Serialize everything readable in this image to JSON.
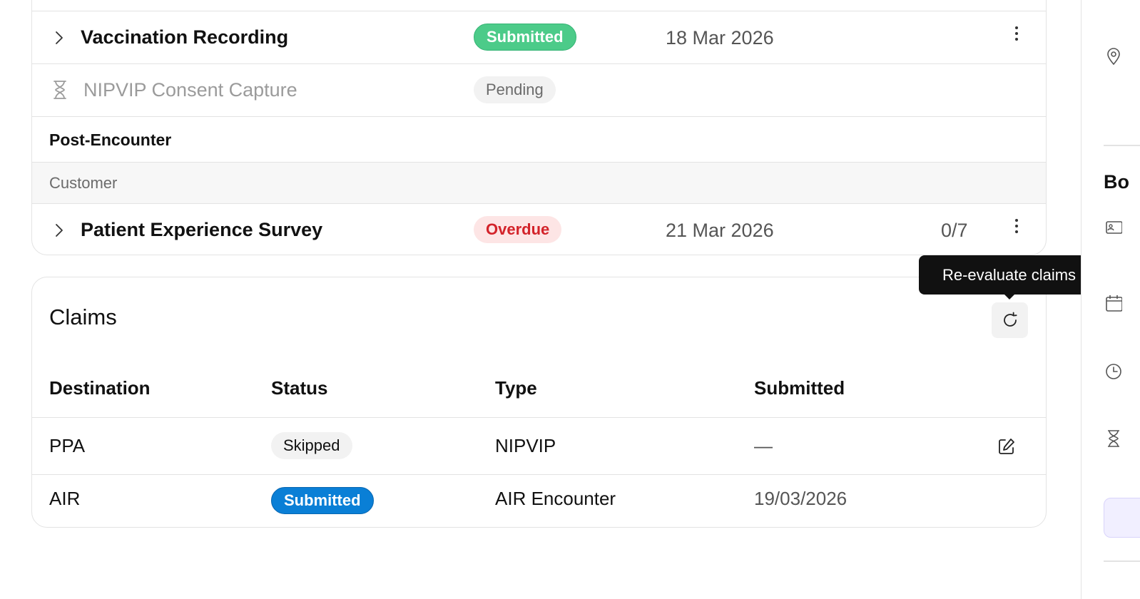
{
  "tasks": {
    "rows": [
      {
        "name": "Vaccination Recording",
        "status": "Submitted",
        "date": "18 Mar 2026"
      },
      {
        "name": "NIPVIP Consent Capture",
        "status": "Pending"
      }
    ],
    "section": "Post-Encounter",
    "group": "Customer",
    "post_rows": [
      {
        "name": "Patient Experience Survey",
        "status": "Overdue",
        "date": "21 Mar 2026",
        "count": "0/7"
      }
    ]
  },
  "claims": {
    "title": "Claims",
    "refresh_tooltip": "Re-evaluate claims",
    "columns": [
      "Destination",
      "Status",
      "Type",
      "Submitted"
    ],
    "rows": [
      {
        "destination": "PPA",
        "status": "Skipped",
        "type": "NIPVIP",
        "submitted": "—"
      },
      {
        "destination": "AIR",
        "status": "Submitted",
        "type": "AIR Encounter",
        "submitted": "19/03/2026"
      }
    ]
  },
  "side_panel": {
    "heading": "Bo"
  },
  "colors": {
    "submitted_green": "#4ccb89",
    "submitted_blue": "#0a7fd6",
    "overdue_bg": "#fde5e5",
    "overdue_text": "#d3232a",
    "pending_bg": "#f2f2f2"
  },
  "icons": [
    "chevron-right-icon",
    "hourglass-icon",
    "kebab-menu-icon",
    "refresh-icon",
    "edit-icon",
    "location-pin-icon",
    "id-card-icon",
    "calendar-icon",
    "clock-icon"
  ]
}
